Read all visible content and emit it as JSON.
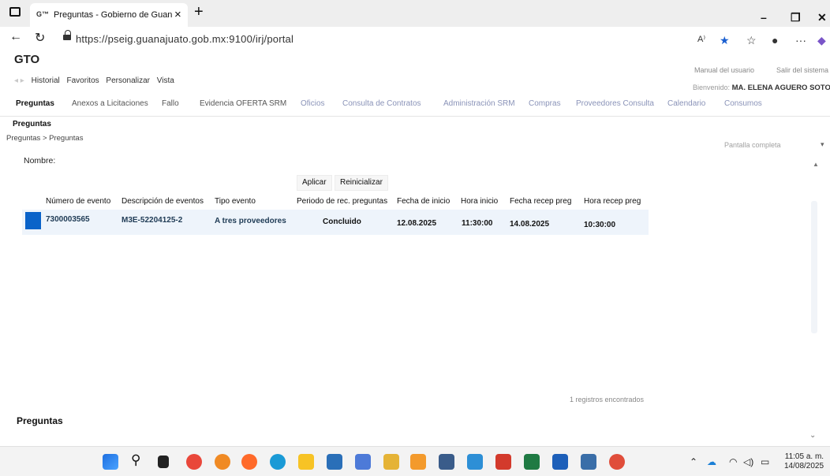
{
  "browser": {
    "tab_title": "Preguntas - Gobierno de Guanaj",
    "tab_close": "×",
    "new_tab": "+",
    "url": "https://pseig.guanajuato.gob.mx:9100/irj/portal",
    "window_min": "–",
    "window_restore": "❐",
    "window_close": "✕"
  },
  "portal": {
    "logo": "GTO",
    "menu": [
      "Historial",
      "Favoritos",
      "Personalizar",
      "Vista"
    ],
    "top_links": [
      "Manual del usuario",
      "Salir del sistema"
    ],
    "welcome_label": "Bienvenido:",
    "user_name": "MA. ELENA AGUERO SOTO"
  },
  "tabs": [
    {
      "label": "Preguntas",
      "active": true
    },
    {
      "label": "Anexos a Licitaciones",
      "active": false
    },
    {
      "label": "Fallo",
      "active": false
    },
    {
      "label": "Evidencia OFERTA SRM",
      "active": false
    },
    {
      "label": "Oficios",
      "active": false
    },
    {
      "label": "Consulta de Contratos",
      "active": false
    },
    {
      "label": "Administración SRM",
      "active": false
    },
    {
      "label": "Compras",
      "active": false
    },
    {
      "label": "Proveedores Consulta",
      "active": false
    },
    {
      "label": "Calendario",
      "active": false
    },
    {
      "label": "Consumos",
      "active": false
    }
  ],
  "page": {
    "title": "Preguntas",
    "breadcrumb": "Preguntas  >  Preguntas",
    "full_screen": "Pantalla completa",
    "filter_label": "Nombre:",
    "apply_button": "Aplicar",
    "reset_button": "Reinicializar",
    "records_text": "1 registros encontrados",
    "section_title": "Preguntas"
  },
  "table": {
    "columns": [
      "Número de evento",
      "Descripción de eventos",
      "Tipo evento",
      "Periodo de rec. preguntas",
      "Fecha de inicio",
      "Hora inicio",
      "Fecha recep preg",
      "Hora recep preg"
    ],
    "rows": [
      {
        "event_number": "7300003565",
        "description": "M3E-52204125-2",
        "event_type": "A tres proveedores",
        "period": "Concluido",
        "start_date": "12.08.2025",
        "start_time": "11:30:00",
        "recep_date": "14.08.2025",
        "recep_time": "10:30:00"
      }
    ]
  },
  "taskbar": {
    "time": "11:05 a. m.",
    "date": "14/08/2025"
  }
}
